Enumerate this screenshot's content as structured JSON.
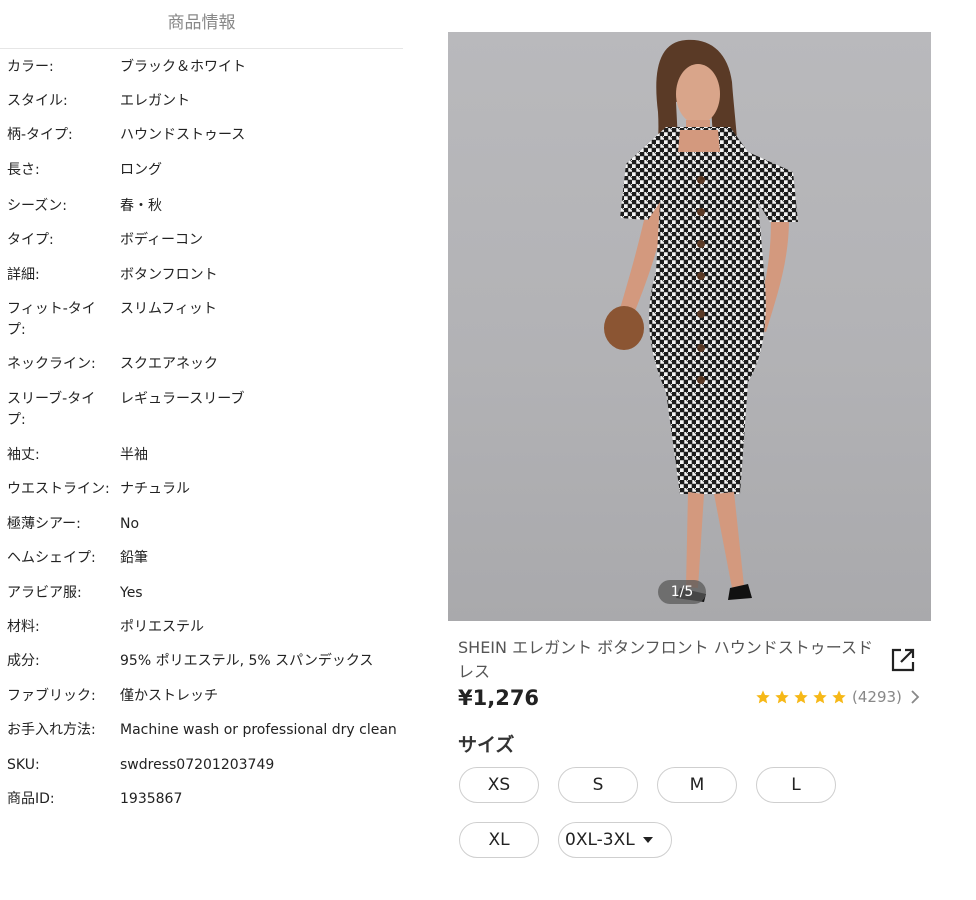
{
  "info": {
    "title": "商品情報",
    "attributes": [
      {
        "key": "カラー:",
        "value": "ブラック＆ホワイト"
      },
      {
        "key": "スタイル:",
        "value": "エレガント"
      },
      {
        "key": "柄-タイプ:",
        "value": "ハウンドストゥース"
      },
      {
        "key": "長さ:",
        "value": "ロング"
      },
      {
        "key": "シーズン:",
        "value": "春・秋"
      },
      {
        "key": "タイプ:",
        "value": "ボディーコン"
      },
      {
        "key": "詳細:",
        "value": "ボタンフロント"
      },
      {
        "key_line1": "フィット-タイ",
        "key_line2": "プ:",
        "value": "スリムフィット"
      },
      {
        "key": "ネックライン:",
        "value": "スクエアネック"
      },
      {
        "key_line1": "スリーブ-タイ",
        "key_line2": "プ:",
        "value": "レギュラースリーブ"
      },
      {
        "key": "袖丈:",
        "value": "半袖"
      },
      {
        "key": "ウエストライン:",
        "value": "ナチュラル"
      },
      {
        "key": "極薄シアー:",
        "value": "No"
      },
      {
        "key": "ヘムシェイプ:",
        "value": "鉛筆"
      },
      {
        "key": "アラビア服:",
        "value": "Yes"
      },
      {
        "key": "材料:",
        "value": "ポリエステル"
      },
      {
        "key": "成分:",
        "value": "95% ポリエステル, 5% スパンデックス"
      },
      {
        "key": "ファブリック:",
        "value": "僅かストレッチ"
      },
      {
        "key": "お手入れ方法:",
        "value": "Machine wash or professional dry clean"
      },
      {
        "key": "SKU:",
        "value": "swdress07201203749"
      },
      {
        "key": "商品ID:",
        "value": "1935867"
      }
    ]
  },
  "product": {
    "image_counter": "1/5",
    "title": "SHEIN エレガント ボタンフロント ハウンドストゥースドレス",
    "price": "¥1,276",
    "rating_stars": 5,
    "rating_count": "(4293)",
    "star_color": "#f6b817",
    "share_icon": "share-icon",
    "size_label": "サイズ",
    "sizes": [
      "XS",
      "S",
      "M",
      "L",
      "XL"
    ],
    "size_dropdown": "0XL-3XL"
  }
}
